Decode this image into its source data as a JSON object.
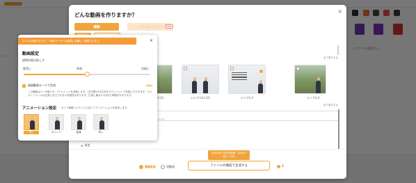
{
  "background": {
    "side_label": "レイアウトを選択する"
  },
  "dialog": {
    "title": "どんな動画を作りますか？",
    "close_icon": "×",
    "tabs": [
      {
        "label": "講義"
      },
      {
        "label": "シミュレーション"
      }
    ],
    "new_badge": "New",
    "sub_tabs": [
      "講義動画",
      "スライドショー"
    ],
    "see_all_1": "全て表示する",
    "see_all_2": "全て表示する",
    "templates": [
      {
        "name": ""
      },
      {
        "name": "シンプル2人(3)"
      },
      {
        "name": "シンプル2人(2)"
      },
      {
        "name": "シンプル1"
      },
      {
        "name": "シンプル3"
      }
    ],
    "body_text": "ート）",
    "setting_label": "設定",
    "quota_line1": "今月の残り作成可能数: 20000+",
    "quota_line2": "残り: 5/50",
    "modes": [
      {
        "label": "講義動画",
        "selected": true
      },
      {
        "label": "短動画",
        "selected": false
      }
    ],
    "generate_label": "ファイルの構成で生成する",
    "credit_value": "2",
    "accent_color": "#f0a53c"
  },
  "panel": {
    "banner": "プランのお知らせです。一部のユーザーは品質に影響して推奨できます。",
    "title": "動画設定",
    "detail_label": "説明内容の詳しさ",
    "slider": {
      "labels": [
        "簡潔に",
        "普通",
        "詳細に"
      ],
      "value_fraction": 0.5
    },
    "hq_label": "高級動画モードで生成",
    "hq_badge": "New",
    "hq_desc": "この機能はベータ版です。2クレジットを消費します。(文字数50万文字までクレジットで利用いただけます。テキストファイルは正常に出力されない可能性があります。生成に最大2-3分ほど時間がかかります。",
    "anim_title": "アニメーション設定",
    "anim_sub": "セリフ情報コンテンツに応じてアニメーションを設定します。",
    "anim_options": [
      {
        "label": "早い",
        "selected": true
      },
      {
        "label": "ゆっくり",
        "selected": false
      },
      {
        "label": "普通",
        "selected": false
      },
      {
        "label": "早い",
        "selected": false
      }
    ]
  }
}
